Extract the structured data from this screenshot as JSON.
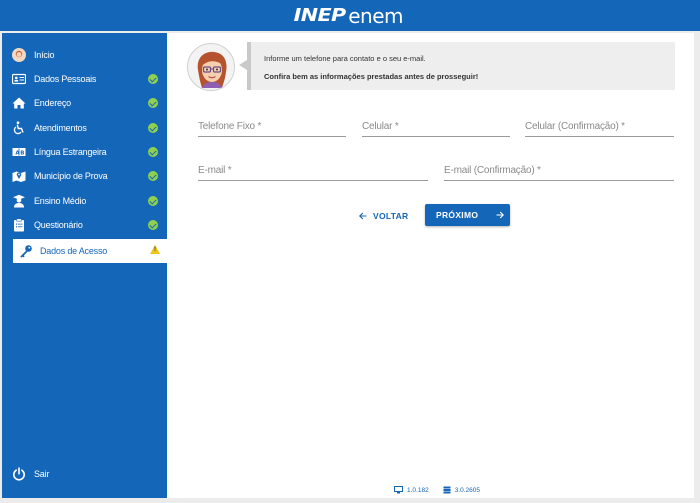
{
  "header": {
    "logo_part1": "INEP",
    "logo_part2": "enem"
  },
  "sidebar": {
    "items": [
      {
        "label": "Início",
        "status": "none"
      },
      {
        "label": "Dados Pessoais",
        "status": "done"
      },
      {
        "label": "Endereço",
        "status": "done"
      },
      {
        "label": "Atendimentos",
        "status": "done"
      },
      {
        "label": "Língua Estrangeira",
        "status": "done"
      },
      {
        "label": "Município de Prova",
        "status": "done"
      },
      {
        "label": "Ensino Médio",
        "status": "done"
      },
      {
        "label": "Questionário",
        "status": "done"
      },
      {
        "label": "Dados de Acesso",
        "status": "warning"
      }
    ],
    "logout_label": "Sair"
  },
  "message": {
    "line1": "Informe um telefone para contato e o seu e-mail.",
    "line2": "Confira bem as informações prestadas antes de prosseguir!"
  },
  "form": {
    "telefone_placeholder": "Telefone Fixo *",
    "celular_placeholder": "Celular *",
    "celular_conf_placeholder": "Celular (Confirmação) *",
    "email_placeholder": "E-mail *",
    "email_conf_placeholder": "E-mail (Confirmação) *"
  },
  "buttons": {
    "back_label": "VOLTAR",
    "next_label": "PRÓXIMO"
  },
  "footer": {
    "client_version": "1.0.182",
    "server_version": "3.0.2605"
  },
  "colors": {
    "primary": "#1466b8",
    "check": "#8fd14f",
    "warning": "#f0c419"
  }
}
